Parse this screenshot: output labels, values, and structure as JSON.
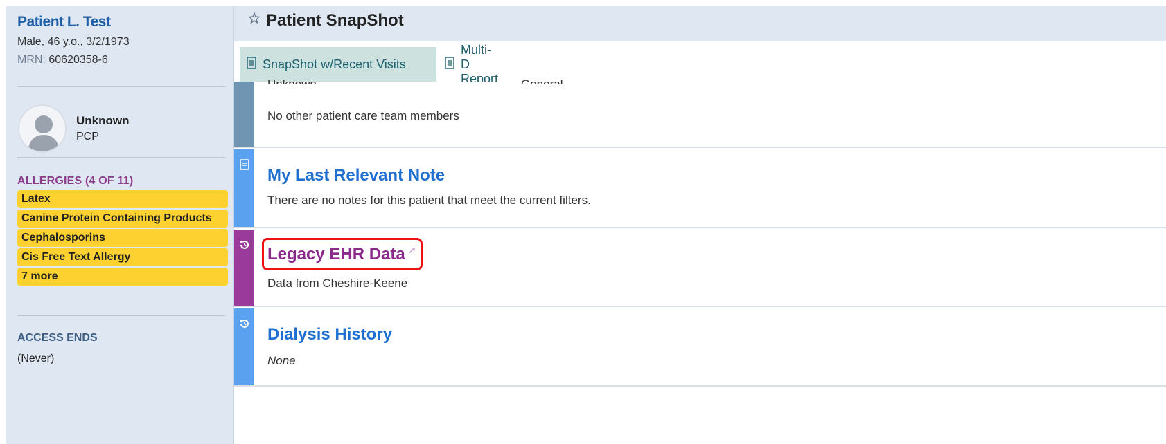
{
  "patient": {
    "name": "Patient L. Test",
    "demographics": "Male, 46 y.o., 3/2/1973",
    "mrn_label": "MRN:",
    "mrn_value": "60620358-6"
  },
  "pcp": {
    "name": "Unknown",
    "role": "PCP"
  },
  "allergies": {
    "header": "ALLERGIES (4 OF 11)",
    "items": [
      "Latex",
      "Canine Protein Containing Products",
      "Cephalosporins",
      "Cis Free Text Allergy",
      "7 more"
    ]
  },
  "access": {
    "header": "ACCESS ENDS",
    "value": "(Never)"
  },
  "main": {
    "title": "Patient SnapShot",
    "tabs": [
      {
        "label": "SnapShot w/Recent Visits",
        "active": true
      },
      {
        "label": "Multi-D Report",
        "active": false
      }
    ],
    "care_team": {
      "cut_left": "Unknown",
      "cut_right": "General",
      "text": "No other patient care team members",
      "color": "#7095b3"
    },
    "last_note": {
      "title": "My Last Relevant Note",
      "text": "There are no notes for this patient that meet the current filters.",
      "color": "#5aa2f0"
    },
    "legacy": {
      "title": "Legacy EHR Data",
      "text": "Data from Cheshire-Keene",
      "color": "#9a3a9a"
    },
    "dialysis": {
      "title": "Dialysis History",
      "text": "None",
      "color": "#5aa2f0"
    }
  },
  "colors": {
    "sidebar_bg": "#dfe7f2",
    "allergy_bg": "#fdd12f",
    "link_blue": "#1f6fd1",
    "legacy_purple": "#8c2a8c",
    "highlight_red": "#e11111"
  }
}
